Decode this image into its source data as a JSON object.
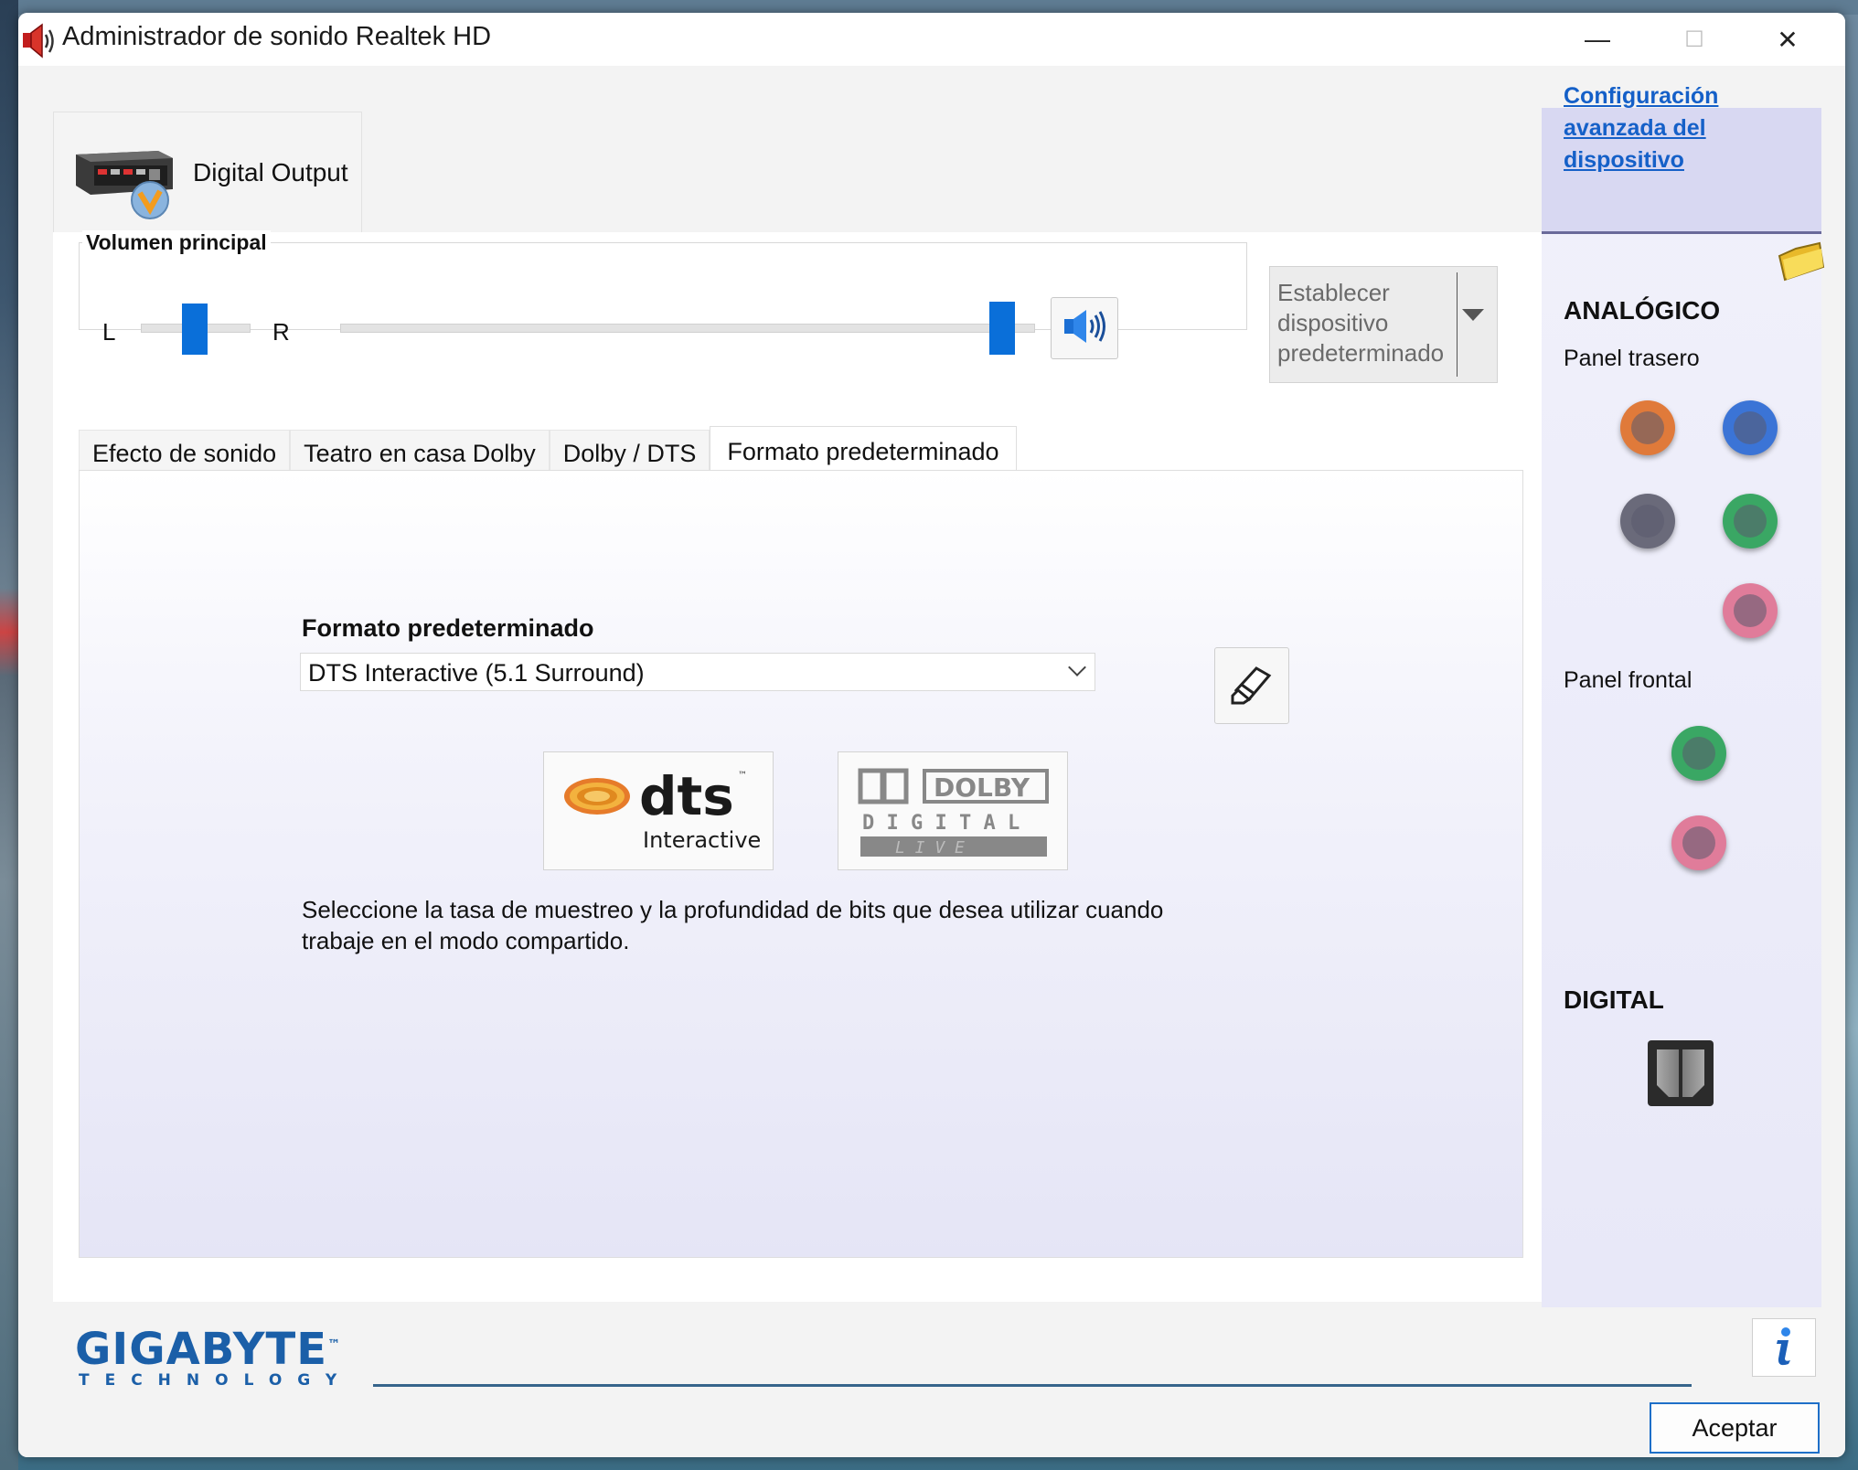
{
  "window": {
    "title": "Administrador de sonido Realtek HD",
    "controls": {
      "minimize": "—",
      "maximize": "☐",
      "close": "✕"
    }
  },
  "device_tab": {
    "label": "Digital Output",
    "icon": "digital-output-device-icon"
  },
  "volume": {
    "title": "Volumen principal",
    "left_label": "L",
    "right_label": "R",
    "balance": 0.5,
    "level": 1.0,
    "mute_icon": "speaker-icon"
  },
  "default_device": {
    "label": "Establecer dispositivo predeterminado"
  },
  "tabs": [
    {
      "label": "Efecto de sonido",
      "active": false
    },
    {
      "label": "Teatro en casa Dolby",
      "active": false
    },
    {
      "label": "Dolby / DTS",
      "active": false
    },
    {
      "label": "Formato predeterminado",
      "active": true
    }
  ],
  "format_panel": {
    "heading": "Formato predeterminado",
    "selected_format": "DTS Interactive (5.1 Surround)",
    "reset_icon": "eraser-icon",
    "logos": {
      "dts": {
        "mark": "dts",
        "tm": "™",
        "sub": "Interactive"
      },
      "dolby": {
        "mark": "DOLBY",
        "line2": "D I G I T A L",
        "line3": "L I V E"
      }
    },
    "description": "Seleccione la tasa de muestreo y la profundidad de bits que desea utilizar cuando trabaje en el modo compartido."
  },
  "right_panel": {
    "advanced_link": "Configuración avanzada del dispositivo",
    "folder_icon": "folder-icon",
    "analog_heading": "ANALÓGICO",
    "rear_panel": "Panel trasero",
    "front_panel": "Panel frontal",
    "digital_heading": "DIGITAL",
    "rear_jacks": [
      "#e07a3a",
      "#3b74d6",
      "#6a6a7a",
      "#3aa764",
      "#e07c9a"
    ],
    "front_jacks": [
      "#3aa764",
      "#e07c9a"
    ]
  },
  "footer": {
    "brand": "GIGABYTE",
    "brand_sub": "TECHNOLOGY",
    "tm": "™",
    "info_icon": "info-icon",
    "ok_label": "Aceptar"
  }
}
